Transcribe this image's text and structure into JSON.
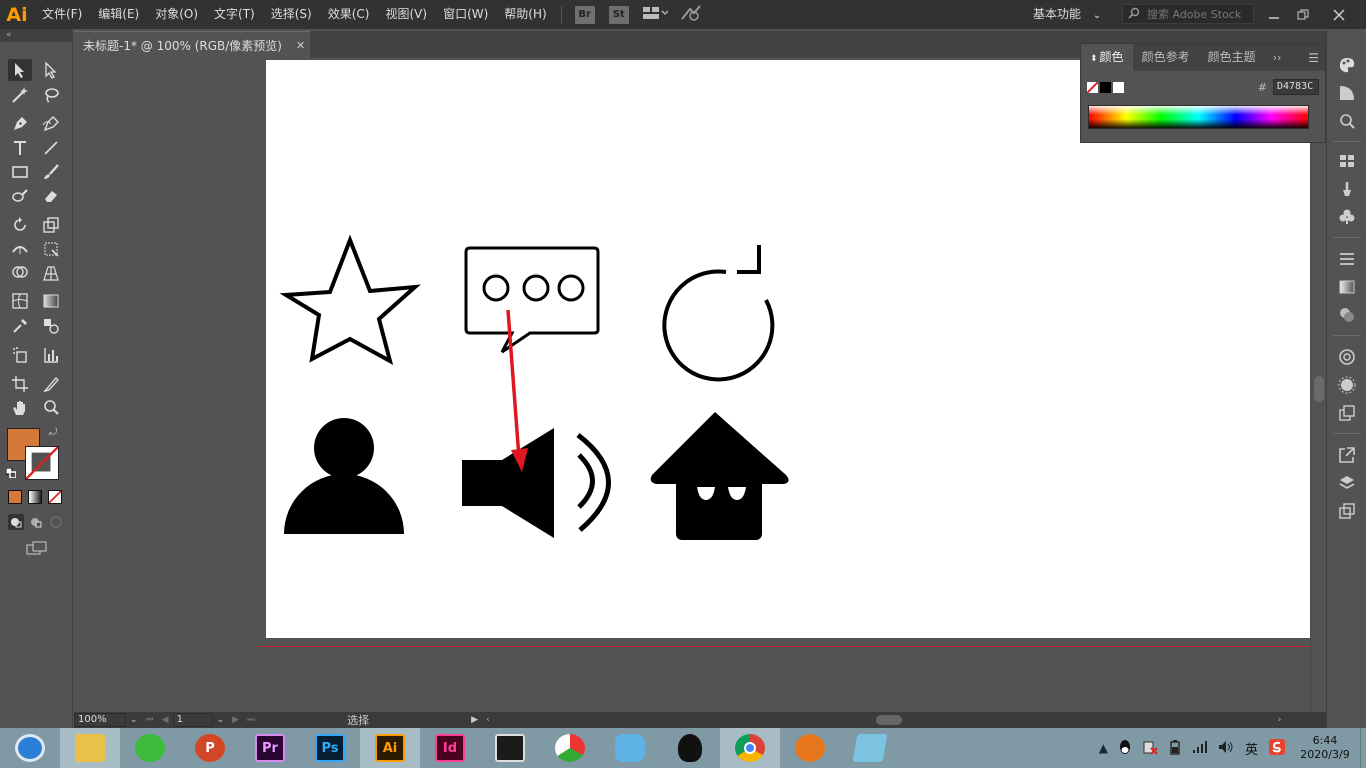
{
  "app": {
    "logo": "Ai"
  },
  "menubar": {
    "items": [
      "文件(F)",
      "编辑(E)",
      "对象(O)",
      "文字(T)",
      "选择(S)",
      "效果(C)",
      "视图(V)",
      "窗口(W)",
      "帮助(H)"
    ],
    "bridge_label": "Br",
    "stock_label": "St",
    "workspace": "基本功能",
    "search_placeholder": "搜索 Adobe Stock"
  },
  "document": {
    "tab_title": "未标题-1* @ 100% (RGB/像素预览)",
    "close_glyph": "✕"
  },
  "statusbar": {
    "zoom": "100%",
    "artboard_number": "1",
    "label": "选择"
  },
  "color_panel": {
    "tabs": [
      "颜色",
      "颜色参考",
      "颜色主题"
    ],
    "active_tab": "颜色",
    "hex_symbol": "#",
    "hex_value": "D4783C"
  },
  "colors": {
    "fill": "#d4783c",
    "accent": "#ff9a00",
    "annotation_arrow": "#e0171f",
    "artboard_border": "#c7282a"
  },
  "artwork": {
    "icons": [
      "star-outline-icon",
      "chat-bubble-dots-icon",
      "refresh-icon",
      "user-icon",
      "speaker-icon",
      "house-icon"
    ]
  },
  "taskbar": {
    "apps": [
      {
        "name": "browser",
        "label": "",
        "color": "#2a7fd6"
      },
      {
        "name": "file-explorer",
        "label": "",
        "color": "#e8c14a"
      },
      {
        "name": "wechat",
        "label": "",
        "color": "#3dbb3a"
      },
      {
        "name": "powerpoint",
        "label": "P",
        "color": "#d24726"
      },
      {
        "name": "premiere",
        "label": "Pr",
        "color": "#2a0634"
      },
      {
        "name": "photoshop",
        "label": "Ps",
        "color": "#061e2f"
      },
      {
        "name": "illustrator",
        "label": "Ai",
        "color": "#2c1a03"
      },
      {
        "name": "indesign",
        "label": "Id",
        "color": "#49021f"
      },
      {
        "name": "video-editor",
        "label": "",
        "color": "#1a1a1a"
      },
      {
        "name": "media-app",
        "label": "",
        "color": "#e44"
      },
      {
        "name": "cloud-app",
        "label": "",
        "color": "#5fb2e6"
      },
      {
        "name": "qq",
        "label": "",
        "color": "#111"
      },
      {
        "name": "chrome",
        "label": "",
        "color": "#3b8be0"
      },
      {
        "name": "fox-app",
        "label": "",
        "color": "#e8761c"
      },
      {
        "name": "notes-app",
        "label": "",
        "color": "#7cc3e2"
      }
    ],
    "ime_label": "英",
    "time": "6:44",
    "date": "2020/3/9"
  }
}
